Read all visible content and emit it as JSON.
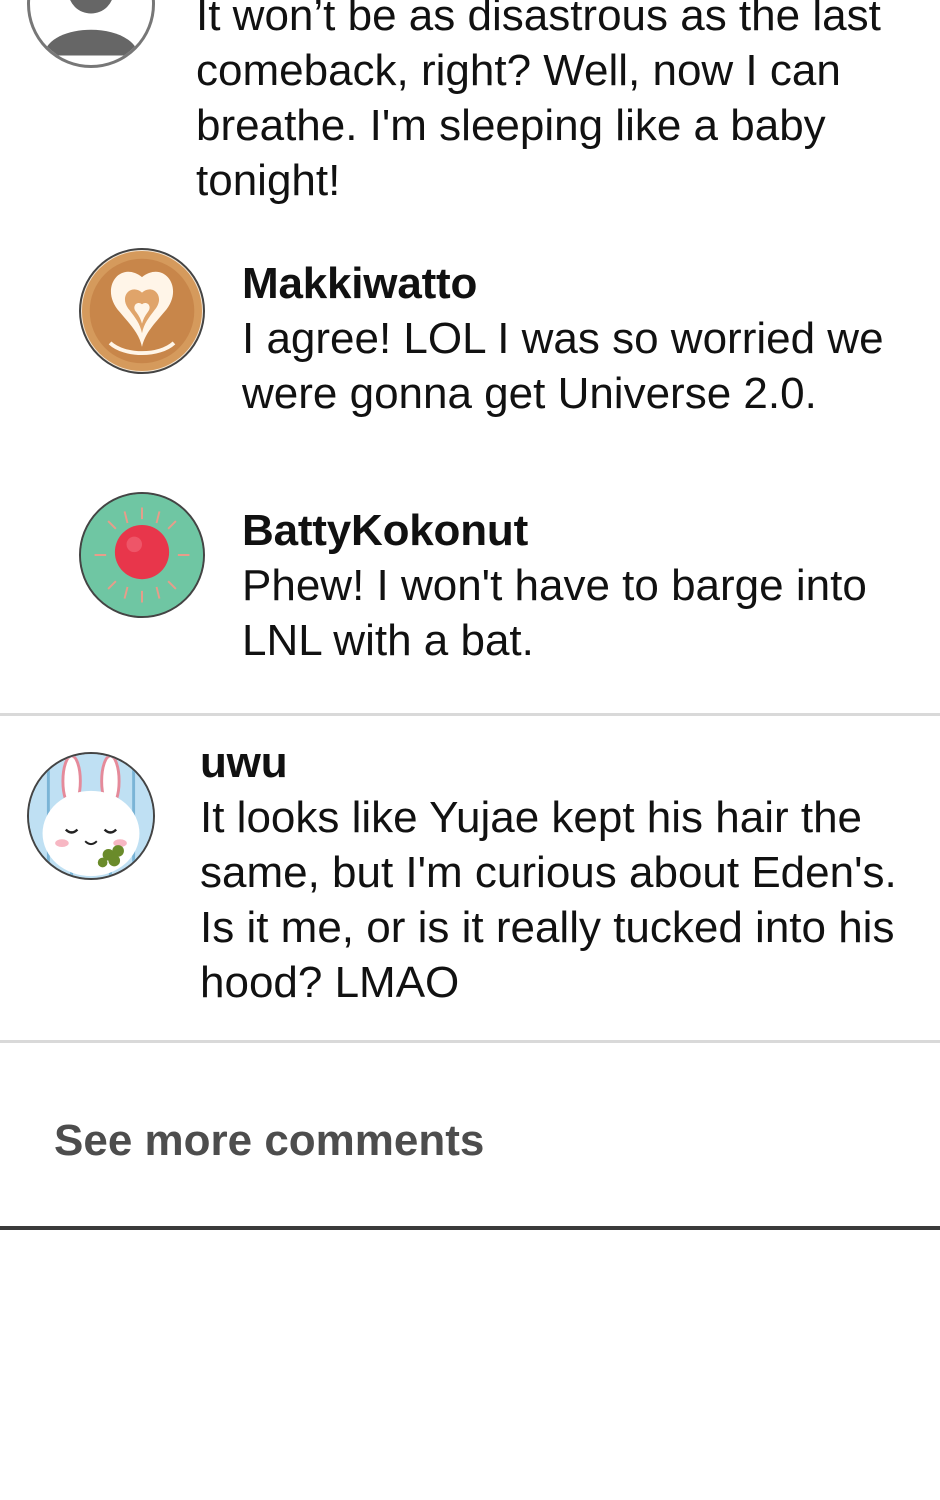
{
  "comments": [
    {
      "username": "",
      "avatar": "default-user-icon",
      "text": "It won’t be as disastrous as the last comeback, right? Well, now I can breathe. I'm sleeping like a baby tonight!"
    },
    {
      "username": "Makkiwatto",
      "avatar": "latte-art-icon",
      "text": "I agree! LOL I was so worried we were gonna get Universe 2.0."
    },
    {
      "username": "BattyKokonut",
      "avatar": "red-dot-sun-icon",
      "text": "Phew! I won't have to barge into LNL with a bat."
    },
    {
      "username": "uwu",
      "avatar": "bunny-icon",
      "text": "It looks like Yujae kept his hair the same, but I'm curious about Eden's. Is it me, or is it really tucked into his hood? LMAO"
    }
  ],
  "see_more_label": "See more comments",
  "colors": {
    "text": "#111111",
    "divider": "#d9d9d9",
    "see_more": "#4d4d4d",
    "bottom_rule": "#3a3a3a"
  }
}
